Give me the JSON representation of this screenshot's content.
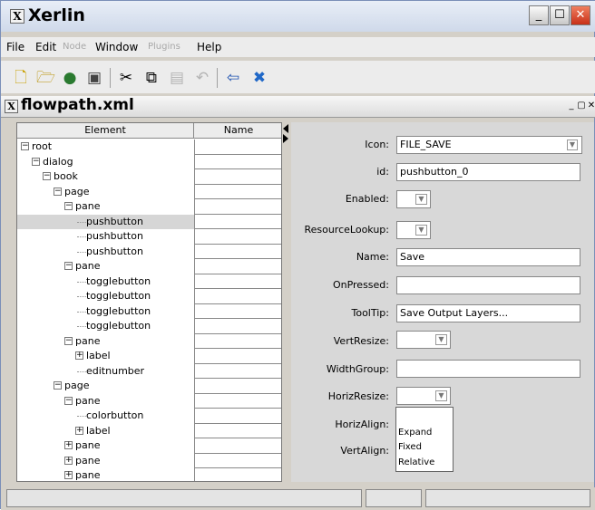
{
  "window": {
    "title": "Xerlin",
    "logo": "X"
  },
  "menu": {
    "items": [
      {
        "label": "File",
        "enabled": true
      },
      {
        "label": "Edit",
        "enabled": true
      },
      {
        "label": "Node",
        "enabled": false
      },
      {
        "label": "Window",
        "enabled": true
      },
      {
        "label": "Plugins",
        "enabled": false
      },
      {
        "label": "Help",
        "enabled": true
      }
    ]
  },
  "toolbar": {
    "icons": [
      "new-document-icon",
      "open-folder-icon",
      "globe-icon",
      "save-icon",
      "cut-icon",
      "copy-icon",
      "paste-icon",
      "undo-icon",
      "back-arrow-icon",
      "delete-x-icon"
    ]
  },
  "document": {
    "title": "flowpath.xml",
    "logo": "X"
  },
  "tree": {
    "headers": {
      "element": "Element",
      "name": "Name"
    },
    "rows": [
      {
        "label": "root",
        "level": 0,
        "node": "minus"
      },
      {
        "label": "dialog",
        "level": 1,
        "node": "minus"
      },
      {
        "label": "book",
        "level": 2,
        "node": "minus"
      },
      {
        "label": "page",
        "level": 3,
        "node": "minus"
      },
      {
        "label": "pane",
        "level": 4,
        "node": "minus"
      },
      {
        "label": "pushbutton",
        "level": 5,
        "node": "leaf",
        "selected": true
      },
      {
        "label": "pushbutton",
        "level": 5,
        "node": "leaf"
      },
      {
        "label": "pushbutton",
        "level": 5,
        "node": "leaf"
      },
      {
        "label": "pane",
        "level": 4,
        "node": "minus"
      },
      {
        "label": "togglebutton",
        "level": 5,
        "node": "leaf"
      },
      {
        "label": "togglebutton",
        "level": 5,
        "node": "leaf"
      },
      {
        "label": "togglebutton",
        "level": 5,
        "node": "leaf"
      },
      {
        "label": "togglebutton",
        "level": 5,
        "node": "leaf"
      },
      {
        "label": "pane",
        "level": 4,
        "node": "minus"
      },
      {
        "label": "label",
        "level": 5,
        "node": "plus"
      },
      {
        "label": "editnumber",
        "level": 5,
        "node": "leaf"
      },
      {
        "label": "page",
        "level": 3,
        "node": "minus"
      },
      {
        "label": "pane",
        "level": 4,
        "node": "minus"
      },
      {
        "label": "colorbutton",
        "level": 5,
        "node": "leaf"
      },
      {
        "label": "label",
        "level": 5,
        "node": "plus"
      },
      {
        "label": "pane",
        "level": 4,
        "node": "plus"
      },
      {
        "label": "pane",
        "level": 4,
        "node": "plus"
      },
      {
        "label": "pane",
        "level": 4,
        "node": "plus"
      }
    ]
  },
  "properties": {
    "icon": {
      "label": "Icon:",
      "value": "FILE_SAVE"
    },
    "id": {
      "label": "id:",
      "value": "pushbutton_0"
    },
    "enabled": {
      "label": "Enabled:"
    },
    "resource_lookup": {
      "label": "ResourceLookup:"
    },
    "name": {
      "label": "Name:",
      "value": "Save"
    },
    "on_pressed": {
      "label": "OnPressed:",
      "value": ""
    },
    "tooltip": {
      "label": "ToolTip:",
      "value": "Save Output Layers..."
    },
    "vert_resize": {
      "label": "VertResize:"
    },
    "width_group": {
      "label": "WidthGroup:",
      "value": ""
    },
    "horiz_resize": {
      "label": "HorizResize:"
    },
    "horiz_align": {
      "label": "HorizAlign:"
    },
    "vert_align": {
      "label": "VertAlign:"
    }
  },
  "dropdown": {
    "options": [
      "",
      "Expand",
      "Fixed",
      "Relative"
    ]
  }
}
